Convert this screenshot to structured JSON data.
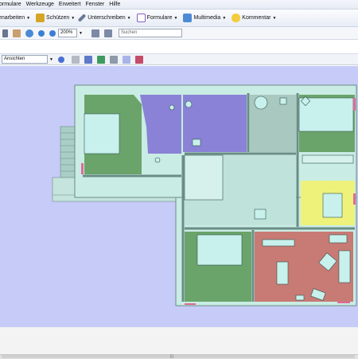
{
  "menu": [
    "ormulare",
    "Werkzeuge",
    "Erweitert",
    "Fenster",
    "Hilfe"
  ],
  "toolbar": {
    "bearbeiten": "enarbeiten",
    "schuetzen": "Schützen",
    "unterschreiben": "Unterschreiben",
    "formulare": "Formulare",
    "multimedia": "Multimedia",
    "kommentar": "Kommentar"
  },
  "nav": {
    "zoom": "200%",
    "search_placeholder": "Suchen"
  },
  "view": {
    "ansichten": "Ansichten"
  },
  "colors": {
    "canvas": "#c6cbf7",
    "wall": "#c9ece4",
    "green_room": "#6aa46a",
    "purple_room": "#8a82d6",
    "yellow_room": "#eef27a",
    "red_room": "#c87a74",
    "gray_room": "#a8c8c0"
  }
}
